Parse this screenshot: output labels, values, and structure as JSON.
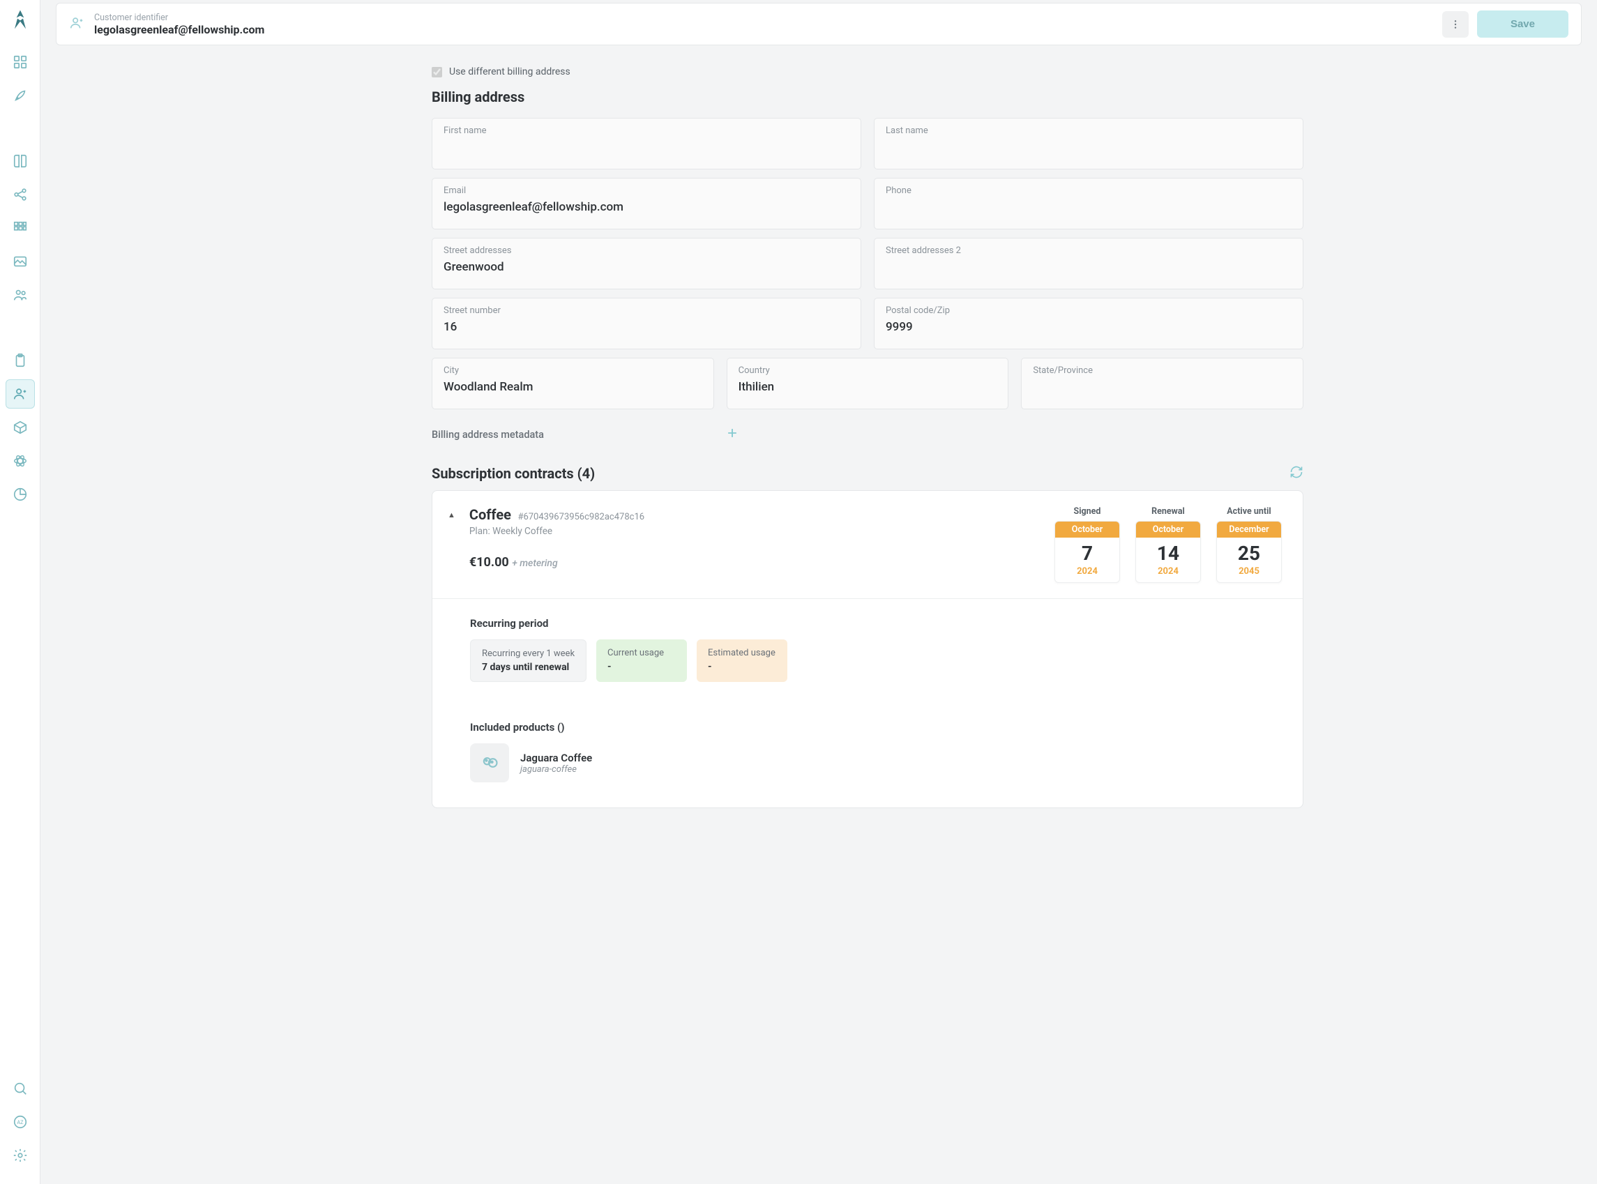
{
  "header": {
    "label": "Customer identifier",
    "value": "legolasgreenleaf@fellowship.com",
    "save_label": "Save"
  },
  "billing": {
    "checkbox_label": "Use different billing address",
    "title": "Billing address",
    "fields": {
      "first_name": {
        "label": "First name",
        "value": ""
      },
      "last_name": {
        "label": "Last name",
        "value": ""
      },
      "email": {
        "label": "Email",
        "value": "legolasgreenleaf@fellowship.com"
      },
      "phone": {
        "label": "Phone",
        "value": ""
      },
      "street": {
        "label": "Street addresses",
        "value": "Greenwood"
      },
      "street2": {
        "label": "Street addresses 2",
        "value": ""
      },
      "street_number": {
        "label": "Street number",
        "value": "16"
      },
      "postal": {
        "label": "Postal code/Zip",
        "value": "9999"
      },
      "city": {
        "label": "City",
        "value": "Woodland Realm"
      },
      "country": {
        "label": "Country",
        "value": "Ithilien"
      },
      "state": {
        "label": "State/Province",
        "value": ""
      }
    },
    "metadata_label": "Billing address metadata"
  },
  "contracts": {
    "title": "Subscription contracts (4)",
    "item": {
      "name": "Coffee",
      "id": "#670439673956c982ac478c16",
      "plan": "Plan: Weekly Coffee",
      "price": "€10.00",
      "metering": "+ metering",
      "dates": {
        "signed": {
          "label": "Signed",
          "month": "October",
          "day": "7",
          "year": "2024"
        },
        "renewal": {
          "label": "Renewal",
          "month": "October",
          "day": "14",
          "year": "2024"
        },
        "active": {
          "label": "Active until",
          "month": "December",
          "day": "25",
          "year": "2045"
        }
      },
      "recurring": {
        "title": "Recurring period",
        "interval_top": "Recurring every 1 week",
        "interval_bottom": "7 days until renewal",
        "current_top": "Current usage",
        "current_bottom": "-",
        "estimated_top": "Estimated usage",
        "estimated_bottom": "-"
      },
      "products": {
        "title": "Included products ()",
        "item": {
          "name": "Jaguara Coffee",
          "slug": "jaguara-coffee"
        }
      }
    }
  }
}
